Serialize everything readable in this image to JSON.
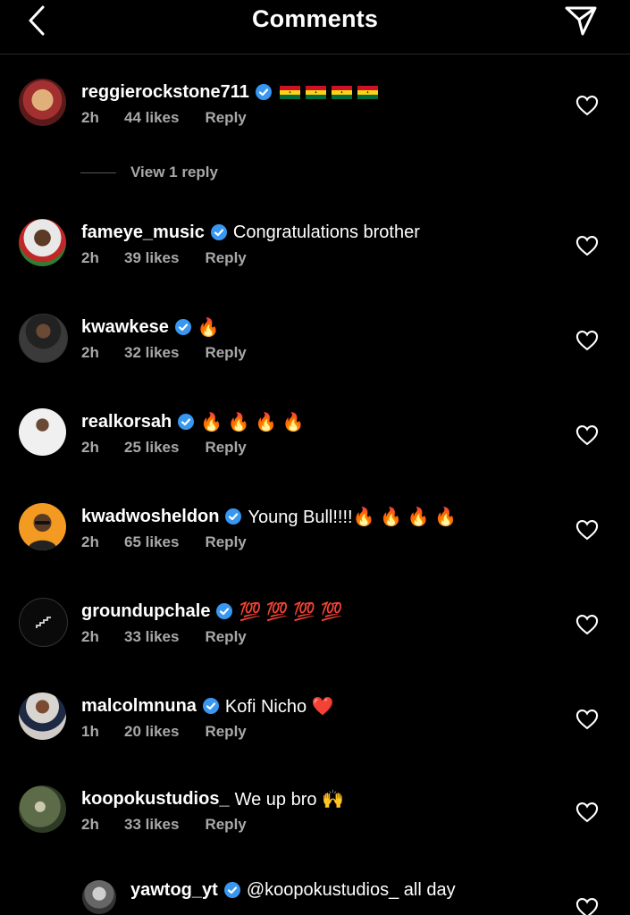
{
  "header": {
    "title": "Comments",
    "back_icon": "chevron-left-icon",
    "send_icon": "send-icon"
  },
  "comments": [
    {
      "user": "reggierockstone711",
      "text": "",
      "emoji": "ghana-flag x4",
      "time": "2h",
      "likes": "44 likes",
      "reply": "Reply",
      "avatar_color": "#8a2b2b"
    },
    {
      "user": "fameye_music",
      "text": "Congratulations brother",
      "time": "2h",
      "likes": "39 likes",
      "reply": "Reply",
      "avatar_color": "#d9d9d9"
    },
    {
      "user": "kwawkese",
      "text": "🔥",
      "time": "2h",
      "likes": "32 likes",
      "reply": "Reply",
      "avatar_color": "#1a1a1a"
    },
    {
      "user": "realkorsah",
      "text": "🔥 🔥 🔥 🔥",
      "time": "2h",
      "likes": "25 likes",
      "reply": "Reply",
      "avatar_color": "#e6e6e6"
    },
    {
      "user": "kwadwosheldon",
      "text": "Young Bull!!!!🔥 🔥 🔥 🔥",
      "time": "2h",
      "likes": "65 likes",
      "reply": "Reply",
      "avatar_color": "#f29a21"
    },
    {
      "user": "groundupchale",
      "text": "💯 💯 💯 💯",
      "time": "2h",
      "likes": "33 likes",
      "reply": "Reply",
      "avatar_color": "#0a0a0a"
    },
    {
      "user": "malcolmnuna",
      "text": "Kofi Nicho ❤️",
      "time": "1h",
      "likes": "20 likes",
      "reply": "Reply",
      "avatar_color": "#c7c2bd"
    },
    {
      "user": "koopokustudios_",
      "text": "We up bro 🙌",
      "time": "2h",
      "likes": "33 likes",
      "reply": "Reply",
      "avatar_color": "#4b5a3c"
    }
  ],
  "view_replies": "View 1 reply",
  "reply_comment": {
    "user": "yawtog_yt",
    "text": "@koopokustudios_ all day",
    "avatar_color": "#777"
  },
  "colors": {
    "background": "#000000",
    "meta": "#a8a8a8",
    "verified": "#3897f0"
  }
}
